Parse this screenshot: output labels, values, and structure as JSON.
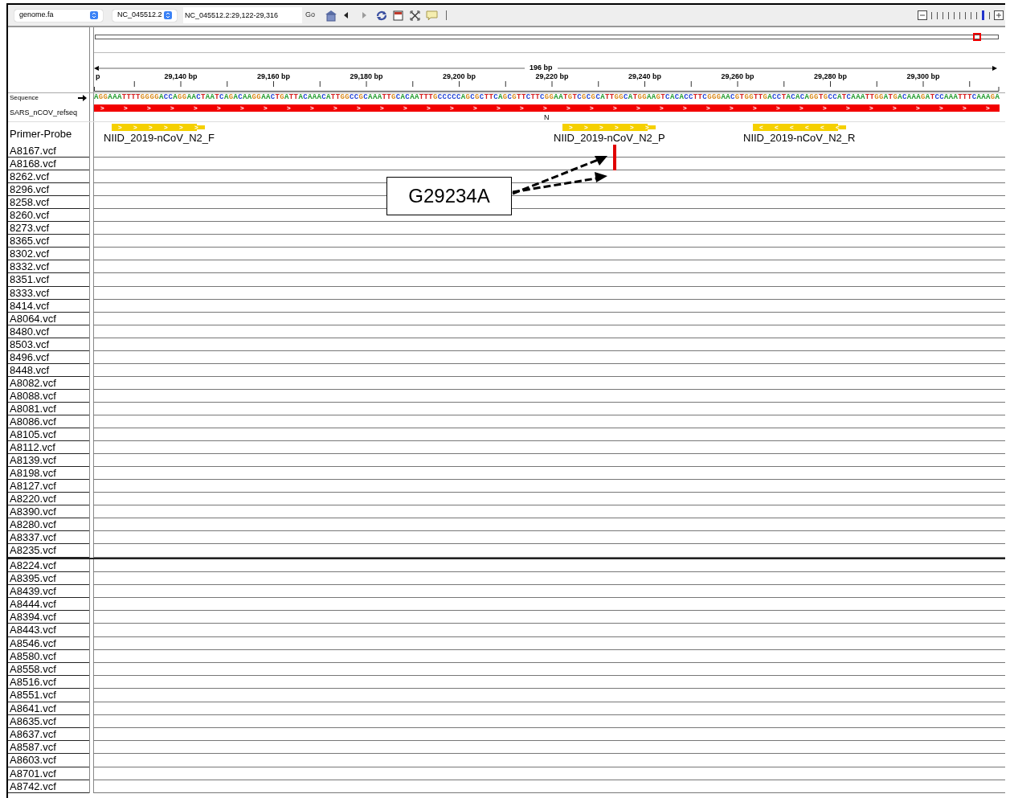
{
  "toolbar": {
    "genome": "genome.fa",
    "chromosome": "NC_045512.2",
    "locus": "NC_045512.2:29,122-29,316",
    "go": "Go",
    "buttons": [
      {
        "kind": "home",
        "disabled": false
      },
      {
        "kind": "back",
        "disabled": false
      },
      {
        "kind": "forward",
        "disabled": true
      },
      {
        "kind": "refresh",
        "disabled": false
      },
      {
        "kind": "ruler",
        "disabled": false
      },
      {
        "kind": "fit",
        "disabled": false
      },
      {
        "kind": "popup",
        "disabled": false
      }
    ],
    "zoom": {
      "level": 0.9
    }
  },
  "ruler": {
    "span": "196 bp",
    "ticks": [
      "p",
      "29,140 bp",
      "29,160 bp",
      "29,180 bp",
      "29,200 bp",
      "29,220 bp",
      "29,240 bp",
      "29,260 bp",
      "29,280 bp",
      "29,300 bp"
    ]
  },
  "sequence_track": {
    "name": "Sequence",
    "bases": "AGGAAATTTTGGGGACCAGGAACTAATCAGACAAGGAACTGATTACAAACATTGGCCGCAAATTGCACAATTTGCCCCCAGCGCTTCAGCGTTCTTCGGAATGTCGCGCATTGGCATGGAAGTCACACCTTCGGGAACGTGGTTGACCTACACAGGTGCCATCAAATTGGATGACAAAGATCCAAATTTCAAAGA"
  },
  "gene_track": {
    "name": "SARS_nCOV_refseq",
    "features": [
      {
        "label": "N",
        "strand": ">"
      }
    ]
  },
  "primer_track": {
    "name": "Primer-Probe",
    "features": [
      {
        "label": "NIID_2019-nCoV_N2_F",
        "strand": ">"
      },
      {
        "label": "NIID_2019-nCoV_N2_P",
        "strand": ">"
      },
      {
        "label": "NIID_2019-nCoV_N2_R",
        "strand": "<"
      }
    ]
  },
  "vcf_panels": [
    {
      "tracks": [
        {
          "name": "A8167.vcf",
          "variant": true
        },
        {
          "name": "A8168.vcf",
          "variant": true
        },
        {
          "name": "8262.vcf",
          "variant": false
        },
        {
          "name": "8296.vcf",
          "variant": false
        },
        {
          "name": "8258.vcf",
          "variant": false
        },
        {
          "name": "8260.vcf",
          "variant": false
        },
        {
          "name": "8273.vcf",
          "variant": false
        },
        {
          "name": "8365.vcf",
          "variant": false
        },
        {
          "name": "8302.vcf",
          "variant": false
        },
        {
          "name": "8332.vcf",
          "variant": false
        },
        {
          "name": "8351.vcf",
          "variant": false
        },
        {
          "name": "8333.vcf",
          "variant": false
        },
        {
          "name": "8414.vcf",
          "variant": false
        },
        {
          "name": "A8064.vcf",
          "variant": false
        },
        {
          "name": "8480.vcf",
          "variant": false
        },
        {
          "name": "8503.vcf",
          "variant": false
        },
        {
          "name": "8496.vcf",
          "variant": false
        },
        {
          "name": "8448.vcf",
          "variant": false
        },
        {
          "name": "A8082.vcf",
          "variant": false
        },
        {
          "name": "A8088.vcf",
          "variant": false
        },
        {
          "name": "A8081.vcf",
          "variant": false
        },
        {
          "name": "A8086.vcf",
          "variant": false
        },
        {
          "name": "A8105.vcf",
          "variant": false
        },
        {
          "name": "A8112.vcf",
          "variant": false
        },
        {
          "name": "A8139.vcf",
          "variant": false
        },
        {
          "name": "A8198.vcf",
          "variant": false
        },
        {
          "name": "A8127.vcf",
          "variant": false
        },
        {
          "name": "A8220.vcf",
          "variant": false
        },
        {
          "name": "A8390.vcf",
          "variant": false
        },
        {
          "name": "A8280.vcf",
          "variant": false
        },
        {
          "name": "A8337.vcf",
          "variant": false
        },
        {
          "name": "A8235.vcf",
          "variant": false
        }
      ]
    },
    {
      "tracks": [
        {
          "name": "A8224.vcf",
          "variant": false
        },
        {
          "name": "A8395.vcf",
          "variant": false
        },
        {
          "name": "A8439.vcf",
          "variant": false
        },
        {
          "name": "A8444.vcf",
          "variant": false
        },
        {
          "name": "A8394.vcf",
          "variant": false
        },
        {
          "name": "A8443.vcf",
          "variant": false
        },
        {
          "name": "A8546.vcf",
          "variant": false
        },
        {
          "name": "A8580.vcf",
          "variant": false
        },
        {
          "name": "A8558.vcf",
          "variant": false
        },
        {
          "name": "A8516.vcf",
          "variant": false
        },
        {
          "name": "A8551.vcf",
          "variant": false
        },
        {
          "name": "A8641.vcf",
          "variant": false
        },
        {
          "name": "A8635.vcf",
          "variant": false
        },
        {
          "name": "A8637.vcf",
          "variant": false
        },
        {
          "name": "A8587.vcf",
          "variant": false
        },
        {
          "name": "A8603.vcf",
          "variant": false
        },
        {
          "name": "A8701.vcf",
          "variant": false
        },
        {
          "name": "A8742.vcf",
          "variant": false
        }
      ]
    }
  ],
  "annotation": {
    "text": "G29234A"
  }
}
